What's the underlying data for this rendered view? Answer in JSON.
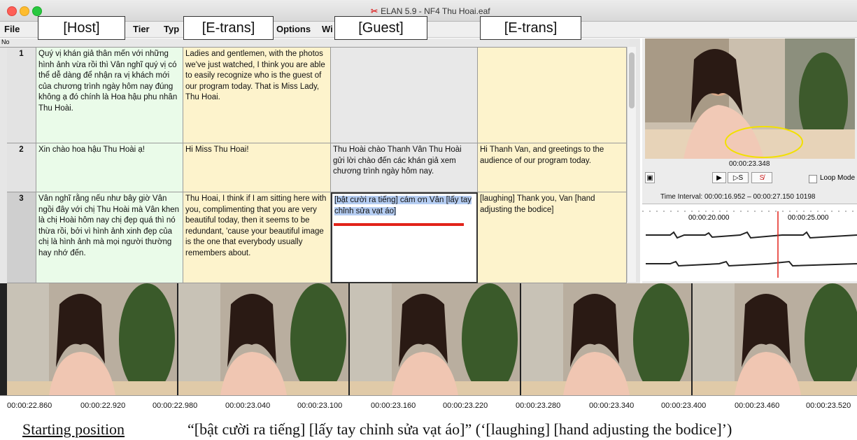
{
  "window": {
    "title": "ELAN 5.9 - NF4 Thu Hoai.eaf"
  },
  "menu": [
    "File",
    "Tier",
    "Typ",
    "Options",
    "Wi"
  ],
  "column_labels": [
    "[Host]",
    "[E-trans]",
    "[Guest]",
    "[E-trans]"
  ],
  "table": {
    "no_header": "No",
    "rows": [
      {
        "no": "1",
        "host": "Quý vị khán giả thân mến với những hình ảnh vừa rồi thì Vân nghĩ quý vị có thể dễ dàng để nhận ra vị khách mới của chương trình ngày hôm nay đúng không ạ đó chính là Hoa hậu phu nhân Thu Hoài.",
        "host_trans": "Ladies and gentlemen, with the photos we've just watched, I think you are able to easily recognize who is the guest of our program today. That is Miss Lady, Thu Hoai.",
        "guest": "",
        "guest_trans": ""
      },
      {
        "no": "2",
        "host": "Xin chào hoa hậu Thu Hoài ạ!",
        "host_trans": "Hi Miss Thu Hoai!",
        "guest": "Thu Hoài chào Thanh Vân Thu Hoài gửi lời chào đến các khán giả xem chương trình ngày hôm nay.",
        "guest_trans": "Hi Thanh Van, and greetings to the audience of our program today."
      },
      {
        "no": "3",
        "host": "Vân nghĩ rằng nếu như bây giờ Vân ngồi đây với chị Thu Hoài mà Vân khen là chị Hoài hôm nay chị đẹp quá thì nó thừa rồi, bởi vì hình ảnh xinh đẹp của chị là hình ảnh mà mọi người thường hay nhớ đến.",
        "host_trans": "Thu Hoai, I think if I am sitting here with you, complimenting that you are very beautiful today, then it seems to be redundant, 'cause your beautiful image is the one that everybody usually remembers about.",
        "guest": "[bật cười ra tiếng]  cám ơn Vân [lấy tay chỉnh sửa vạt áo]",
        "guest_trans": "[laughing] Thank you, Van [hand adjusting the bodice]"
      }
    ]
  },
  "player": {
    "current_time": "00:00:23.348",
    "controls": [
      "▶",
      "▷S",
      "S̸"
    ],
    "loop_label": "Loop Mode",
    "time_interval": "Time Interval: 00:00:16.952 – 00:00:27.150  10198",
    "wave_ticks": [
      "00:00:20.000",
      "00:00:25.000"
    ]
  },
  "filmstrip": {
    "timestamps": [
      "00:00:22.860",
      "00:00:22.920",
      "00:00:22.980",
      "00:00:23.040",
      "00:00:23.100",
      "00:00:23.160",
      "00:00:23.220",
      "00:00:23.280",
      "00:00:23.340",
      "00:00:23.400",
      "00:00:23.460",
      "00:00:23.520"
    ]
  },
  "caption": {
    "left": "Starting position",
    "right": "“[bật cười ra tiếng] [lấy tay chỉnh sửa vạt áo]” (‘[laughing] [hand adjusting the bodice]’)"
  },
  "colors": {
    "host_bg": "#eafbe9",
    "trans_bg": "#fdf3cc",
    "selection": "#b5cdf2",
    "accent_red": "#e2231a"
  }
}
